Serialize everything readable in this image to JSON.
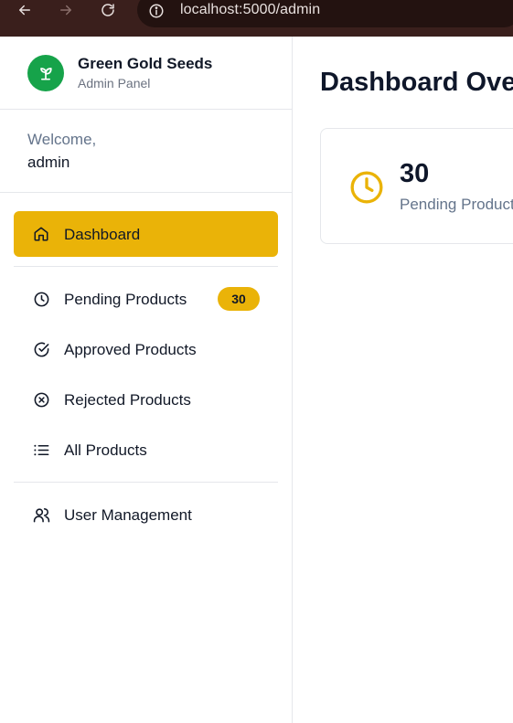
{
  "browser": {
    "url": "localhost:5000/admin"
  },
  "brand": {
    "name": "Green Gold Seeds",
    "subtitle": "Admin Panel"
  },
  "welcome": {
    "label": "Welcome,",
    "user": "admin"
  },
  "nav": {
    "dashboard": {
      "label": "Dashboard",
      "icon": "home-icon"
    },
    "pending": {
      "label": "Pending Products",
      "icon": "clock-icon",
      "badge": "30"
    },
    "approved": {
      "label": "Approved Products",
      "icon": "check-circle-icon"
    },
    "rejected": {
      "label": "Rejected Products",
      "icon": "x-circle-icon"
    },
    "all": {
      "label": "All Products",
      "icon": "list-icon"
    },
    "users": {
      "label": "User Management",
      "icon": "users-icon"
    }
  },
  "main": {
    "title": "Dashboard Overview",
    "stats": [
      {
        "value": "30",
        "label": "Pending Products",
        "icon": "clock-icon"
      }
    ]
  },
  "colors": {
    "accent": "#eab308",
    "brand": "#16a34a",
    "browser_chrome": "#3a1f1c"
  }
}
